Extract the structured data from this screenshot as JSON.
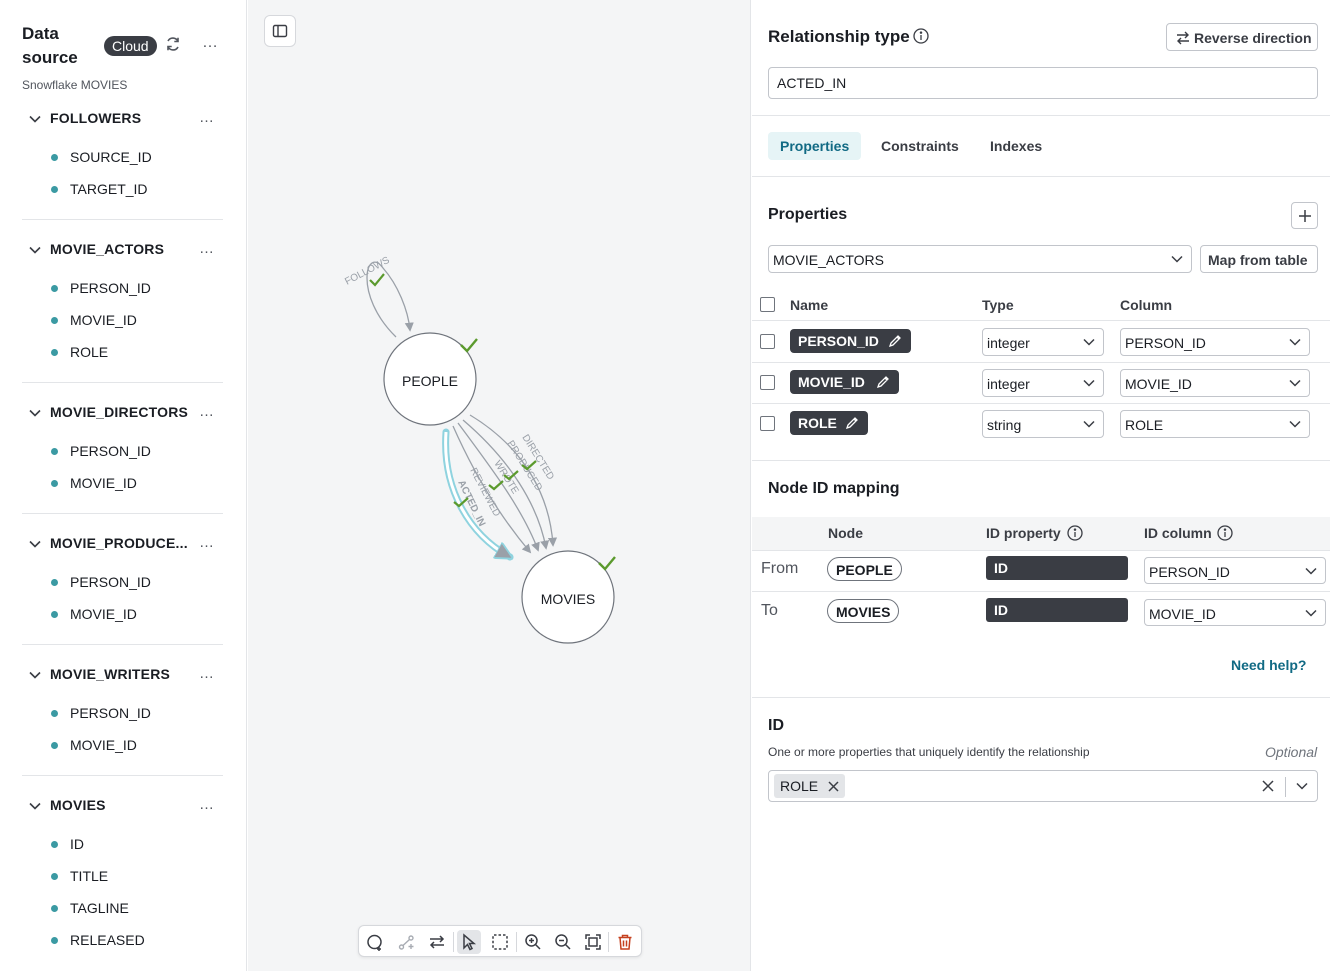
{
  "sidebar": {
    "title": "Data source",
    "badge": "Cloud",
    "subtitle": "Snowflake MOVIES",
    "more_icon": "…",
    "tables": [
      {
        "name": "FOLLOWERS",
        "columns": [
          "SOURCE_ID",
          "TARGET_ID"
        ]
      },
      {
        "name": "MOVIE_ACTORS",
        "columns": [
          "PERSON_ID",
          "MOVIE_ID",
          "ROLE"
        ]
      },
      {
        "name": "MOVIE_DIRECTORS",
        "columns": [
          "PERSON_ID",
          "MOVIE_ID"
        ]
      },
      {
        "name": "MOVIE_PRODUCE...",
        "columns": [
          "PERSON_ID",
          "MOVIE_ID"
        ]
      },
      {
        "name": "MOVIE_WRITERS",
        "columns": [
          "PERSON_ID",
          "MOVIE_ID"
        ]
      },
      {
        "name": "MOVIES",
        "columns": [
          "ID",
          "TITLE",
          "TAGLINE",
          "RELEASED"
        ]
      }
    ]
  },
  "graph": {
    "nodes": [
      {
        "label": "PEOPLE"
      },
      {
        "label": "MOVIES"
      }
    ],
    "edges": [
      "FOLLOWS",
      "DIRECTED",
      "PRODUCED",
      "WROTE",
      "REVIEWED",
      "ACTED_IN"
    ],
    "selected_edge": "ACTED_IN"
  },
  "toolbar": {
    "tools": [
      "add-node",
      "add-relationship",
      "reverse",
      "select",
      "box-select",
      "zoom-in",
      "zoom-out",
      "fit",
      "delete"
    ],
    "active": "select"
  },
  "panel": {
    "relationship_type_label": "Relationship type",
    "reverse_button": "Reverse direction",
    "relationship_type_value": "ACTED_IN",
    "tabs": [
      "Properties",
      "Constraints",
      "Indexes"
    ],
    "active_tab": "Properties",
    "properties": {
      "title": "Properties",
      "source_table": "MOVIE_ACTORS",
      "map_button": "Map from table",
      "headers": {
        "name": "Name",
        "type": "Type",
        "column": "Column"
      },
      "rows": [
        {
          "name": "PERSON_ID",
          "type": "integer",
          "column": "PERSON_ID"
        },
        {
          "name": "MOVIE_ID",
          "type": "integer",
          "column": "MOVIE_ID"
        },
        {
          "name": "ROLE",
          "type": "string",
          "column": "ROLE"
        }
      ]
    },
    "node_id_mapping": {
      "title": "Node ID mapping",
      "headers": {
        "node": "Node",
        "id_property": "ID property",
        "id_column": "ID column"
      },
      "rows": [
        {
          "label": "From",
          "node": "PEOPLE",
          "id_property": "ID",
          "id_column": "PERSON_ID"
        },
        {
          "label": "To",
          "node": "MOVIES",
          "id_property": "ID",
          "id_column": "MOVIE_ID"
        }
      ],
      "help_link": "Need help?"
    },
    "id_section": {
      "title": "ID",
      "description": "One or more properties that uniquely identify the relationship",
      "optional": "Optional",
      "selected": [
        "ROLE"
      ]
    }
  },
  "colors": {
    "accent": "#116a84",
    "dot": "#3b9aa3",
    "check": "#5b9a2d",
    "dark_chip": "#3a3d44",
    "selected_edge": "#8fd3df"
  }
}
